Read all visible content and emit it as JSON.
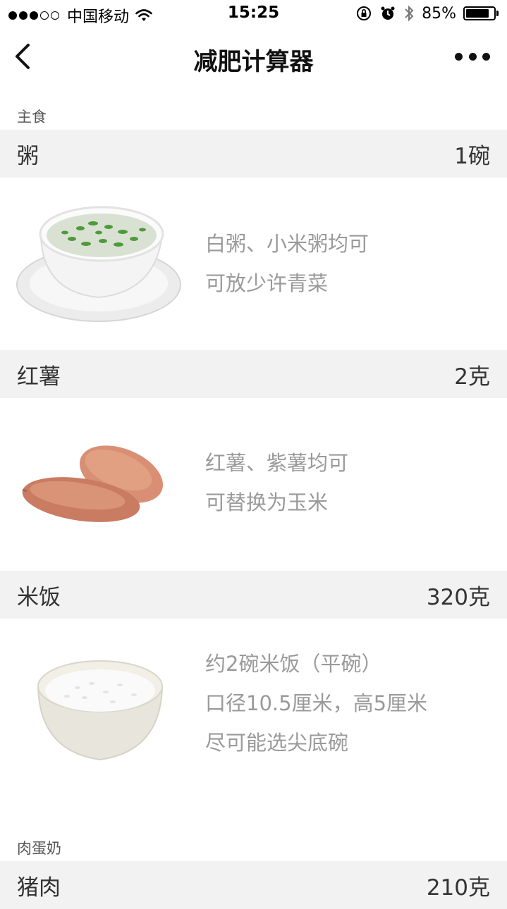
{
  "status_bar": {
    "carrier": "中国移动",
    "time": "15:25",
    "battery": "85%",
    "battery_level": 0.85
  },
  "nav": {
    "title": "减肥计算器"
  },
  "sections": [
    {
      "label": "主食",
      "items": [
        {
          "name": "粥",
          "amount": "1碗",
          "notes": [
            "白粥、小米粥均可",
            "可放少许青菜"
          ],
          "icon": "porridge-bowl"
        },
        {
          "name": "红薯",
          "amount": "2克",
          "notes": [
            "红薯、紫薯均可",
            "可替换为玉米"
          ],
          "icon": "sweet-potato"
        },
        {
          "name": "米饭",
          "amount": "320克",
          "notes": [
            "约2碗米饭（平碗）",
            "口径10.5厘米，高5厘米",
            "尽可能选尖底碗"
          ],
          "icon": "rice-bowl"
        }
      ]
    },
    {
      "label": "肉蛋奶",
      "items": [
        {
          "name": "猪肉",
          "amount": "210克"
        }
      ]
    }
  ]
}
